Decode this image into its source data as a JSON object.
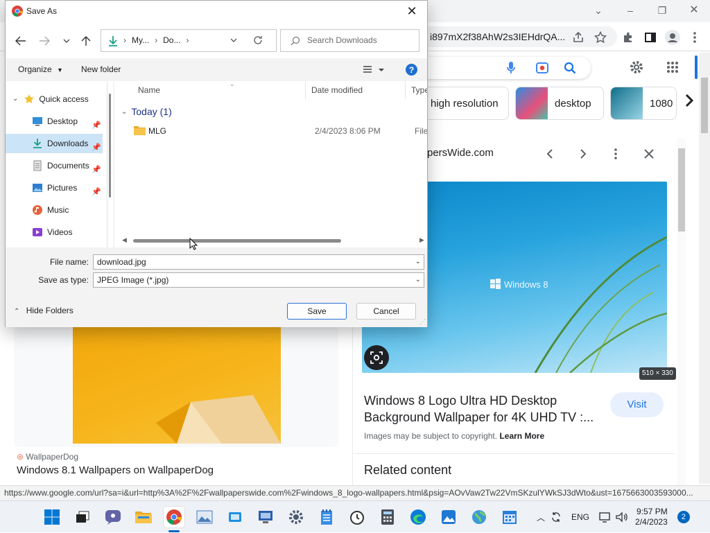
{
  "chrome": {
    "url_text": "i897mX2f38AhW2s3IEHdrQA...",
    "status_url": "https://www.google.com/url?sa=i&url=http%3A%2F%2Fwallpaperswide.com%2Fwindows_8_logo-wallpapers.html&psig=AOvVaw2Tw22VmSKzulYWkSJ3dWto&ust=1675663003593000...",
    "chips": [
      {
        "label": "high resolution"
      },
      {
        "label": "desktop"
      },
      {
        "label": "1080"
      }
    ],
    "panel": {
      "source": "persWide.com",
      "image_logo_text": "Windows 8",
      "size_badge": "510 × 330",
      "title": "Windows 8 Logo Ultra HD Desktop Background Wallpaper for 4K UHD TV :...",
      "visit_label": "Visit",
      "copyright_text": "Images may be subject to copyright.",
      "learn_more": "Learn More",
      "related": "Related content"
    },
    "left_result": {
      "source": "WallpaperDog",
      "title": "Windows 8.1 Wallpapers on WallpaperDog"
    }
  },
  "dialog": {
    "title": "Save As",
    "breadcrumb": [
      "My...",
      "Do..."
    ],
    "search_placeholder": "Search Downloads",
    "organize_label": "Organize",
    "new_folder_label": "New folder",
    "tree": [
      {
        "label": "Quick access",
        "icon": "star-icon",
        "pinned": false,
        "selected": false
      },
      {
        "label": "Desktop",
        "icon": "desktop-icon",
        "pinned": true,
        "selected": false
      },
      {
        "label": "Downloads",
        "icon": "download-icon",
        "pinned": true,
        "selected": true
      },
      {
        "label": "Documents",
        "icon": "document-icon",
        "pinned": true,
        "selected": false
      },
      {
        "label": "Pictures",
        "icon": "pictures-icon",
        "pinned": true,
        "selected": false
      },
      {
        "label": "Music",
        "icon": "music-icon",
        "pinned": false,
        "selected": false
      },
      {
        "label": "Videos",
        "icon": "videos-icon",
        "pinned": false,
        "selected": false
      }
    ],
    "columns": {
      "name": "Name",
      "date": "Date modified",
      "type": "Type"
    },
    "group_label": "Today (1)",
    "files": [
      {
        "name": "MLG",
        "date": "2/4/2023 8:06 PM",
        "type": "File fo"
      }
    ],
    "file_name_label": "File name:",
    "file_name_value": "download.jpg",
    "type_label": "Save as type:",
    "type_value": "JPEG Image (*.jpg)",
    "hide_folders_label": "Hide Folders",
    "save_label": "Save",
    "cancel_label": "Cancel"
  },
  "taskbar": {
    "language": "ENG",
    "time": "9:57 PM",
    "date": "2/4/2023",
    "notification_count": "2"
  },
  "colors": {
    "accent": "#0067c0",
    "selection": "#cce4f7",
    "folder": "#f8c34a"
  }
}
